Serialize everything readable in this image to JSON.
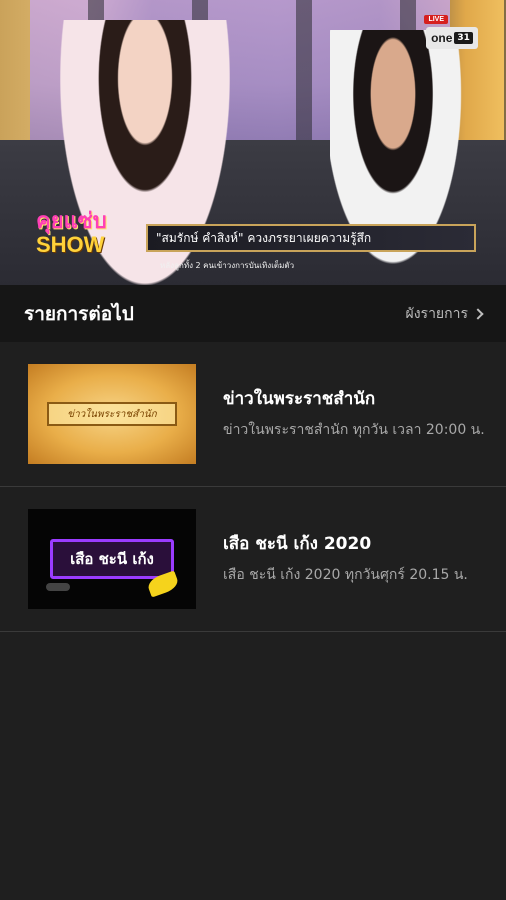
{
  "player": {
    "live_badge": "LIVE",
    "channel_logo": {
      "name": "one",
      "number": "31"
    },
    "show_logo": {
      "line1": "คุยแซ่บ",
      "line2": "SHOW"
    },
    "headline": "\"สมรักษ์ คำสิงห์\" ควงภรรยาเผยความรู้สึก",
    "subline": "หลังลูกทั้ง 2 คนเข้าวงการบันเทิงเต็มตัว"
  },
  "section": {
    "title": "รายการต่อไป",
    "schedule_link": "ผังรายการ"
  },
  "programs": [
    {
      "title": "ข่าวในพระราชสำนัก",
      "description": "ข่าวในพระราชสำนัก ทุกวัน  เวลา 20:00 น.",
      "thumb_text": "ข่าวในพระราชสำนัก"
    },
    {
      "title": "เสือ ชะนี เก้ง 2020",
      "description": "เสือ ชะนี เก้ง 2020 ทุกวันศุกร์ 20.15 น.",
      "thumb_text": "เสือ ชะนี เก้ง"
    }
  ]
}
